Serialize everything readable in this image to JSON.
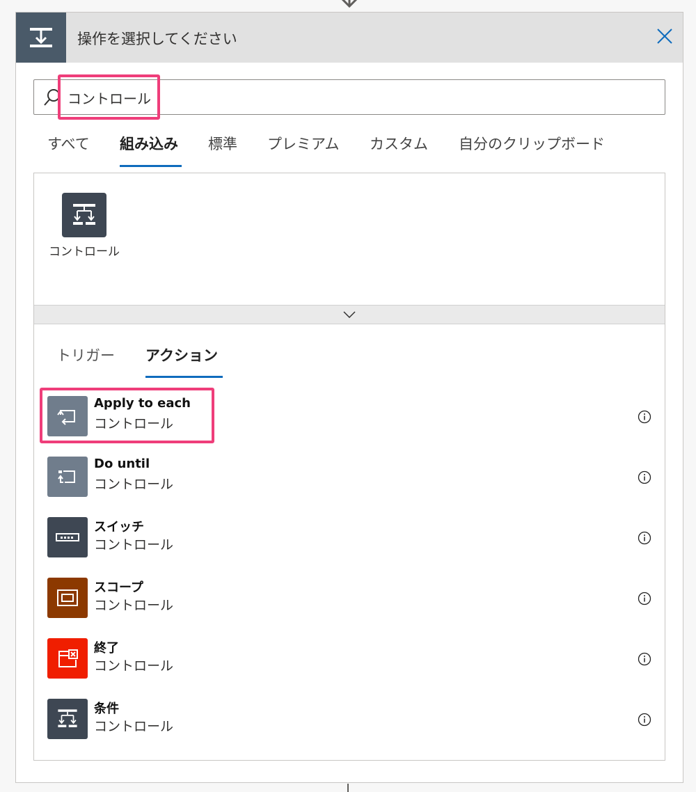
{
  "header": {
    "title": "操作を選択してください",
    "icon": "condition-icon",
    "close_icon": "close-icon"
  },
  "search": {
    "value": "コントロール",
    "placeholder": ""
  },
  "tabs": [
    {
      "label": "すべて",
      "active": false
    },
    {
      "label": "組み込み",
      "active": true
    },
    {
      "label": "標準",
      "active": false
    },
    {
      "label": "プレミアム",
      "active": false
    },
    {
      "label": "カスタム",
      "active": false
    },
    {
      "label": "自分のクリップボード",
      "active": false
    }
  ],
  "connector": {
    "label": "コントロール",
    "icon": "condition-icon",
    "color": "#3e4753"
  },
  "subtabs": [
    {
      "label": "トリガー",
      "active": false
    },
    {
      "label": "アクション",
      "active": true
    }
  ],
  "actions": [
    {
      "name": "Apply to each",
      "connector": "コントロール",
      "icon": "loop-icon",
      "color": "#707d8c"
    },
    {
      "name": "Do until",
      "connector": "コントロール",
      "icon": "do-until-icon",
      "color": "#707d8c"
    },
    {
      "name": "スイッチ",
      "connector": "コントロール",
      "icon": "switch-icon",
      "color": "#3e4753"
    },
    {
      "name": "スコープ",
      "connector": "コントロール",
      "icon": "scope-icon",
      "color": "#8c3900"
    },
    {
      "name": "終了",
      "connector": "コントロール",
      "icon": "terminate-icon",
      "color": "#f01e00"
    },
    {
      "name": "条件",
      "connector": "コントロール",
      "icon": "condition-icon",
      "color": "#3e4753"
    }
  ],
  "colors": {
    "highlight": "#ef3e7a",
    "accent": "#0f6cbd",
    "header_icon_bg": "#4a5a69"
  }
}
